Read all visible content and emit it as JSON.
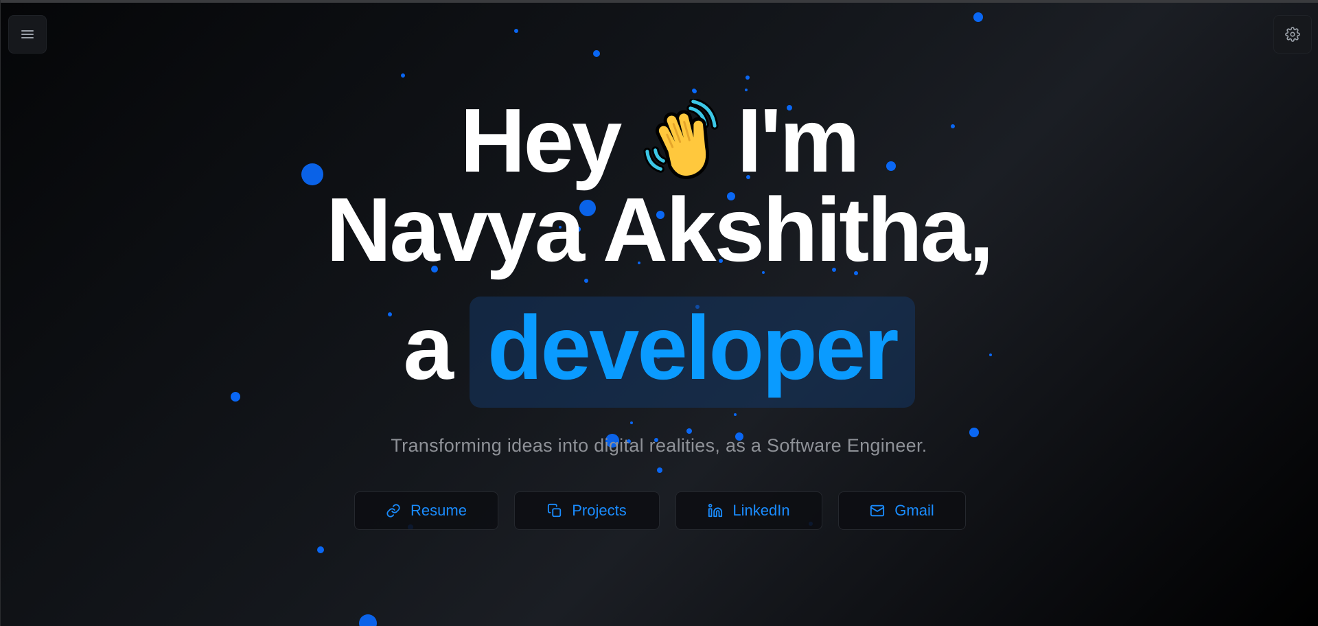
{
  "hero": {
    "greeting": "Hey",
    "intro": "I'm",
    "name": "Navya Akshitha,",
    "article": "a",
    "role": "developer",
    "wave_icon": "waving-hand-icon",
    "subtitle": "Transforming ideas into digital realities, as a Software Engineer."
  },
  "header": {
    "menu_icon": "hamburger-menu-icon",
    "settings_icon": "gear-icon"
  },
  "links": [
    {
      "label": "Resume",
      "icon": "link-icon"
    },
    {
      "label": "Projects",
      "icon": "copy-icon"
    },
    {
      "label": "LinkedIn",
      "icon": "linkedin-icon"
    },
    {
      "label": "Gmail",
      "icon": "mail-icon"
    }
  ],
  "colors": {
    "accent": "#0a9bff",
    "button_text": "#1a8cff",
    "particle": "#0a6cff",
    "subtitle": "#8e9197",
    "role_background": "#14375f"
  }
}
